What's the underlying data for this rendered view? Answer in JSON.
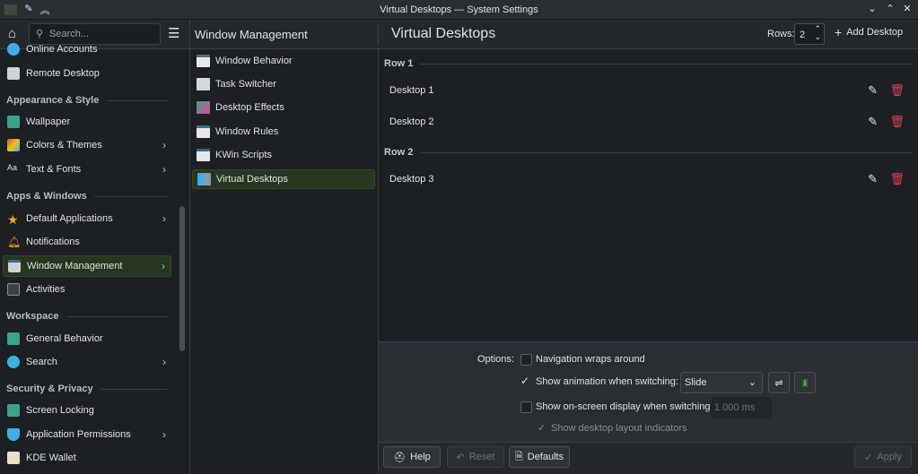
{
  "window": {
    "title": "Virtual Desktops — System Settings"
  },
  "sidebar": {
    "search_placeholder": "Search...",
    "items": [
      {
        "label": "Online Accounts"
      },
      {
        "label": "Remote Desktop"
      },
      {
        "label": "Wallpaper"
      },
      {
        "label": "Colors & Themes"
      },
      {
        "label": "Text & Fonts"
      },
      {
        "label": "Default Applications"
      },
      {
        "label": "Notifications"
      },
      {
        "label": "Window Management"
      },
      {
        "label": "Activities"
      },
      {
        "label": "General Behavior"
      },
      {
        "label": "Search"
      },
      {
        "label": "Screen Locking"
      },
      {
        "label": "Application Permissions"
      },
      {
        "label": "KDE Wallet"
      }
    ],
    "sections": [
      "Appearance & Style",
      "Apps & Windows",
      "Workspace",
      "Security & Privacy"
    ]
  },
  "middle": {
    "title": "Window Management",
    "items": [
      {
        "label": "Window Behavior"
      },
      {
        "label": "Task Switcher"
      },
      {
        "label": "Desktop Effects"
      },
      {
        "label": "Window Rules"
      },
      {
        "label": "KWin Scripts"
      },
      {
        "label": "Virtual Desktops"
      }
    ]
  },
  "main": {
    "title": "Virtual Desktops",
    "rows_label": "Rows:",
    "rows_value": "2",
    "add_label": "Add Desktop",
    "row1": "Row 1",
    "row2": "Row 2",
    "desktops": [
      "Desktop 1",
      "Desktop 2",
      "Desktop 3"
    ]
  },
  "options": {
    "label": "Options:",
    "nav_wraps": "Navigation wraps around",
    "show_anim": "Show animation when switching:",
    "anim_value": "Slide",
    "show_osd": "Show on-screen display when switching:",
    "osd_value": "1 000 ms",
    "layout_ind": "Show desktop layout indicators"
  },
  "footer": {
    "help": "Help",
    "reset": "Reset",
    "defaults": "Defaults",
    "apply": "Apply"
  }
}
